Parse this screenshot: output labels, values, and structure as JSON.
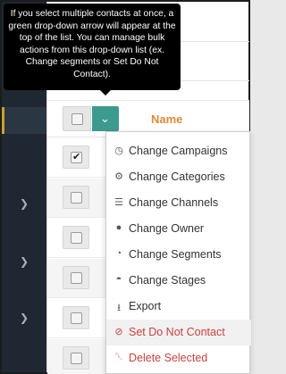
{
  "tooltip": {
    "text": "If you select multiple contacts at once, a green drop-down arrow will appear at the top of the list. You can manage bulk actions from this drop-down list (ex. Change segments or Set Do Not Contact)."
  },
  "table": {
    "name_column": "Name",
    "rows": [
      {
        "checked": true
      },
      {
        "checked": false
      },
      {
        "checked": false
      },
      {
        "checked": false
      },
      {
        "checked": false
      },
      {
        "checked": false
      }
    ]
  },
  "bulk_menu": {
    "items": [
      {
        "label": "Change Campaigns",
        "icon": "clock-icon"
      },
      {
        "label": "Change Categories",
        "icon": "cogs-icon"
      },
      {
        "label": "Change Channels",
        "icon": "list-icon"
      },
      {
        "label": "Change Owner",
        "icon": "user-icon"
      },
      {
        "label": "Change Segments",
        "icon": "pie-chart-icon"
      },
      {
        "label": "Change Stages",
        "icon": "dashboard-icon"
      },
      {
        "label": "Export",
        "icon": "download-icon"
      },
      {
        "label": "Set Do Not Contact",
        "icon": "ban-icon"
      },
      {
        "label": "Delete Selected",
        "icon": "trash-icon"
      }
    ]
  },
  "colors": {
    "sidebar": "#1f2732",
    "dropdown_button": "#3d9a8e",
    "name_column": "#e0883a",
    "danger": "#c6423f"
  }
}
